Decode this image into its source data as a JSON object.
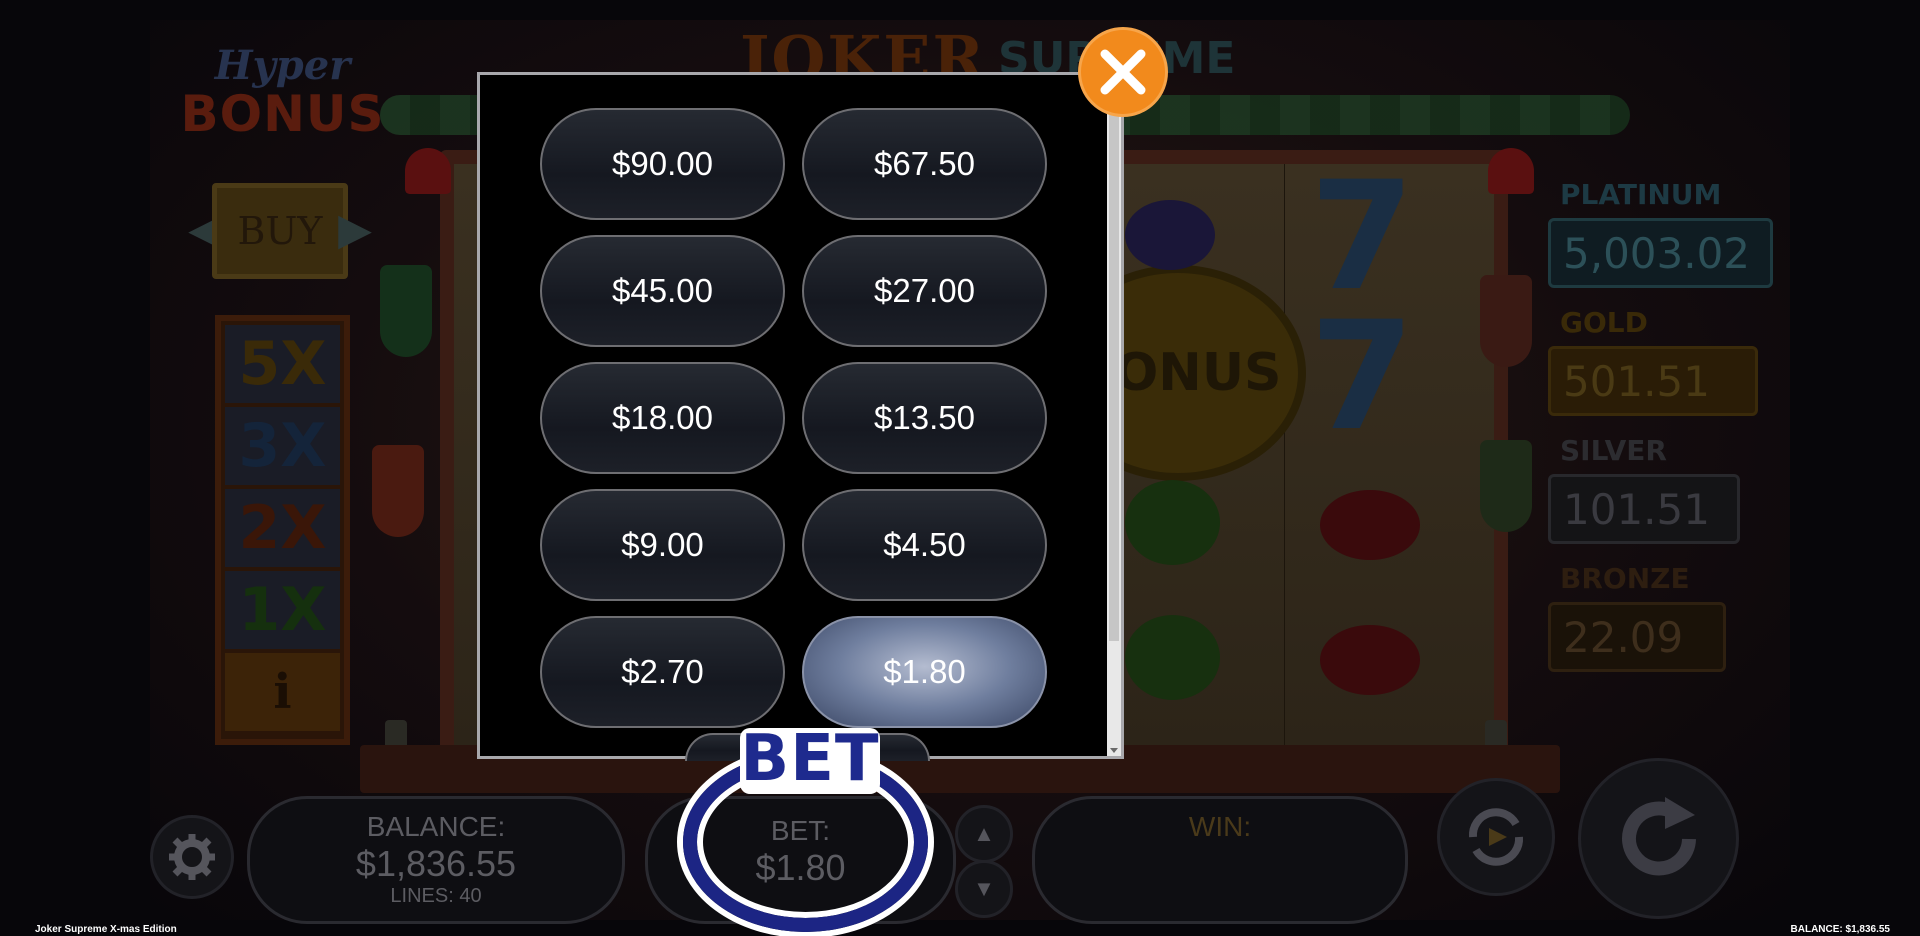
{
  "game_title": "Joker Supreme X-mas Edition",
  "logo": {
    "joker": "JOKER",
    "supreme": "SUPREME"
  },
  "hyper_bonus": {
    "hyper": "Hyper",
    "bonus": "BONUS",
    "buy_label": "BUY",
    "multipliers": [
      "5X",
      "3X",
      "2X",
      "1X"
    ],
    "info_label": "i"
  },
  "jackpots": [
    {
      "name": "PLATINUM",
      "value": "5,003.02",
      "color": "#1d3036"
    },
    {
      "name": "GOLD",
      "value": "501.51",
      "color": "#3a2a08"
    },
    {
      "name": "SILVER",
      "value": "101.51",
      "color": "#2a2a2e"
    },
    {
      "name": "BRONZE",
      "value": "22.09",
      "color": "#2e1e10"
    }
  ],
  "reels": {
    "bonus_symbol": "BONUS",
    "seven": "7"
  },
  "hud": {
    "balance_label": "BALANCE:",
    "balance_value": "$1,836.55",
    "lines_label": "LINES: 40",
    "bet_label": "BET:",
    "bet_value": "$1.80",
    "win_label": "WIN:"
  },
  "bet_dialog": {
    "badge": "BET",
    "options": [
      "$90.00",
      "$67.50",
      "$45.00",
      "$27.00",
      "$18.00",
      "$13.50",
      "$9.00",
      "$4.50",
      "$2.70",
      "$1.80"
    ],
    "selected": "$1.80"
  },
  "footer": {
    "left": "Joker Supreme X-mas Edition",
    "right": "BALANCE: $1,836.55"
  },
  "icons": {
    "close": "close-icon",
    "settings": "gear-icon",
    "autoplay": "autoplay-icon",
    "spin": "spin-icon",
    "arrow_up": "arrow-up-icon",
    "arrow_down": "arrow-down-icon"
  },
  "colors": {
    "close_button": "#f28a1c",
    "selected_bet": "#6f7e9e",
    "bet_badge": "#1e2a8e"
  }
}
